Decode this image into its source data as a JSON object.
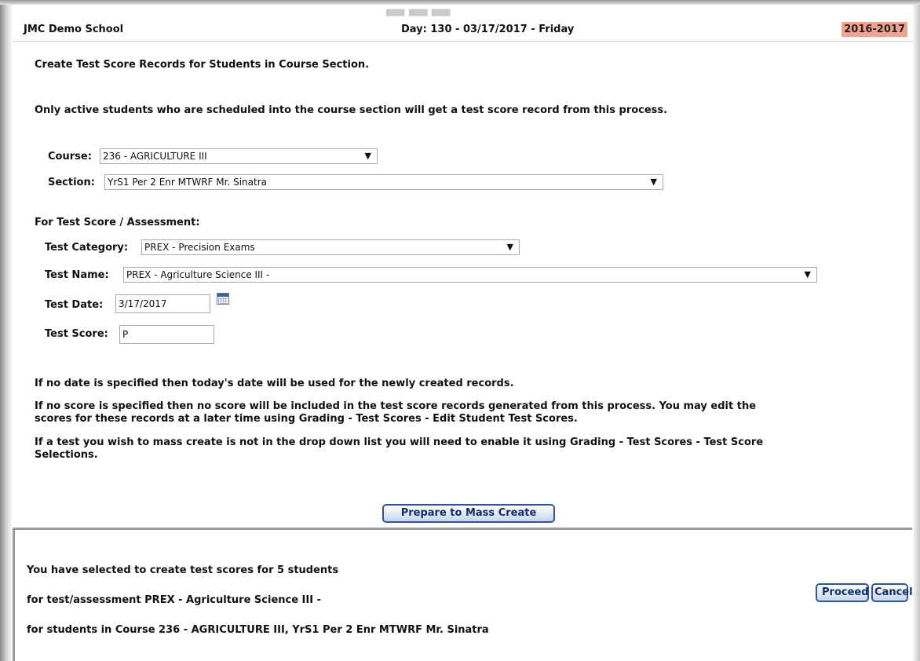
{
  "header": {
    "school_name": "JMC Demo School",
    "day_info": "Day: 130 - 03/17/2017 - Friday",
    "school_year": "2016-2017"
  },
  "page": {
    "title": "Create Test Score Records for Students in Course Section.",
    "note": "Only active students who are scheduled into the course section will get a test score record from this process."
  },
  "form": {
    "course_label": "Course:",
    "course_value": "236 - AGRICULTURE III",
    "section_label": "Section:",
    "section_value": "YrS1 Per 2 Enr MTWRF Mr. Sinatra",
    "assessment_heading": "For Test Score / Assessment:",
    "test_category_label": "Test Category:",
    "test_category_value": "PREX - Precision Exams",
    "test_name_label": "Test Name:",
    "test_name_value": "PREX - Agriculture Science III -",
    "test_date_label": "Test Date:",
    "test_date_value": "3/17/2017",
    "test_score_label": "Test Score:",
    "test_score_value": "P"
  },
  "help": {
    "date_note": "If no date is specified then today's date will be used for the newly created records.",
    "score_note_line1": "If no score is specified then no score will be included in the test score records generated from this process. You may edit the",
    "score_note_line2": "scores for these records at a later time using Grading - Test Scores - Edit Student Test Scores.",
    "test_note_line1": "If a test you wish to mass create is not in the drop down list you will need to enable it using Grading - Test Scores - Test Score",
    "test_note_line2": "Selections."
  },
  "buttons": {
    "prepare": "Prepare to Mass Create",
    "proceed": "Proceed",
    "cancel": "Cancel"
  },
  "confirm": {
    "line1": "You have selected to create test scores for 5 students",
    "line2": "for test/assessment PREX - Agriculture Science III -",
    "line3": "for students in Course 236 - AGRICULTURE III, YrS1 Per 2 Enr MTWRF Mr. Sinatra"
  },
  "icons": {
    "dropdown_arrow": "▼",
    "calendar": "calendar-icon"
  },
  "colors": {
    "school_year_bg": "#f3a28f",
    "button_border": "#2a56a8"
  }
}
